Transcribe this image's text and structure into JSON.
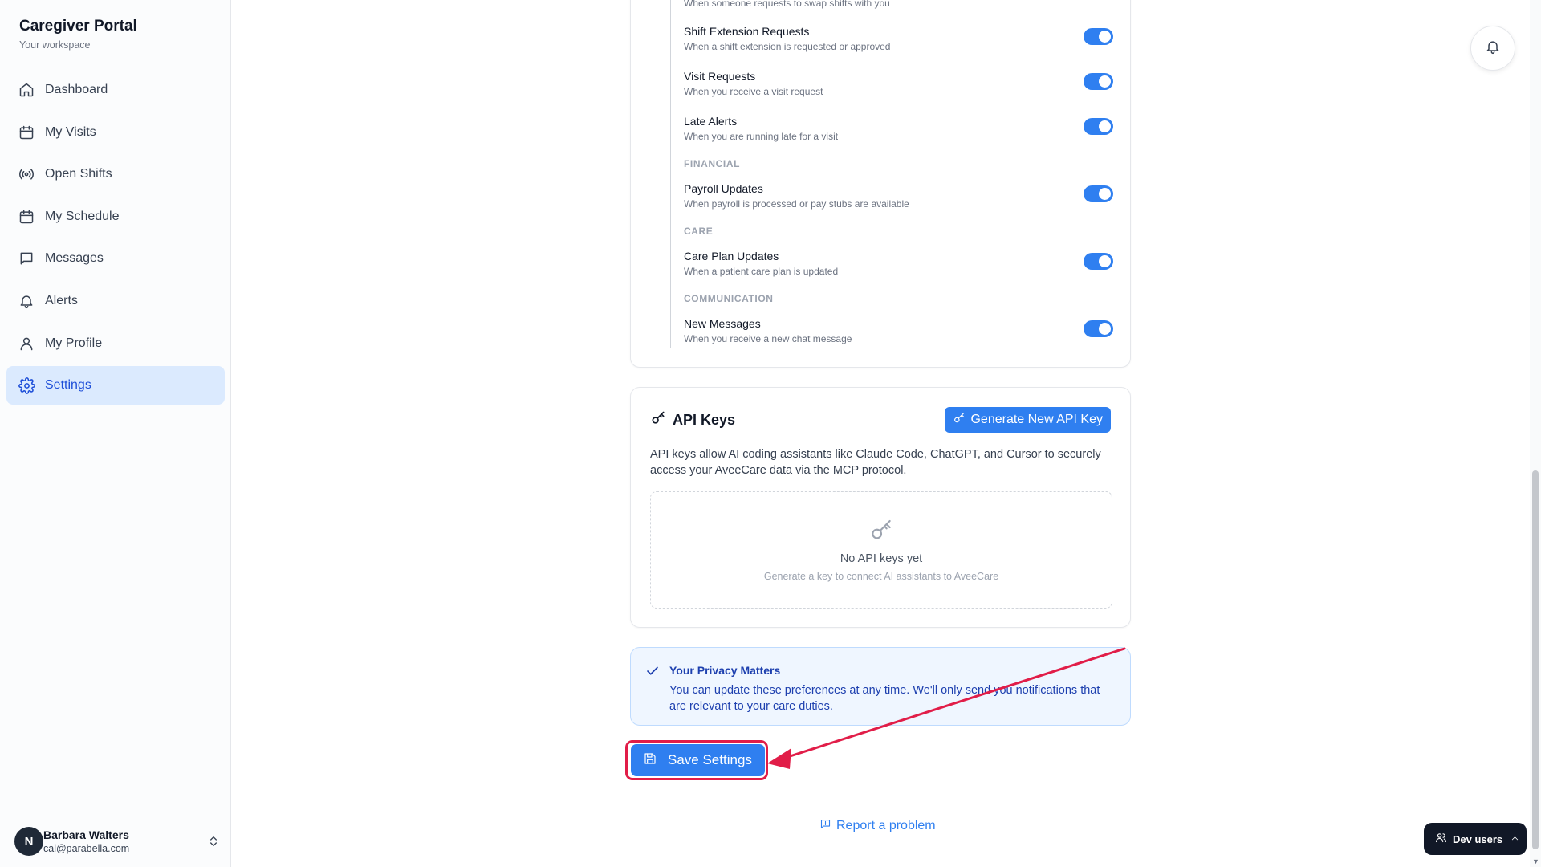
{
  "app": {
    "title": "Caregiver Portal",
    "subtitle": "Your workspace"
  },
  "sidebar": {
    "items": [
      {
        "label": "Dashboard",
        "icon": "home-icon"
      },
      {
        "label": "My Visits",
        "icon": "calendar-icon"
      },
      {
        "label": "Open Shifts",
        "icon": "broadcast-icon"
      },
      {
        "label": "My Schedule",
        "icon": "calendar-icon"
      },
      {
        "label": "Messages",
        "icon": "message-icon"
      },
      {
        "label": "Alerts",
        "icon": "bell-icon"
      },
      {
        "label": "My Profile",
        "icon": "user-icon"
      },
      {
        "label": "Settings",
        "icon": "gear-icon",
        "active": true
      }
    ],
    "user": {
      "initial": "N",
      "name": "Barbara Walters",
      "email": "cal@parabella.com"
    }
  },
  "notifications": {
    "partial_top_desc": "When someone requests to swap shifts with you",
    "rows_a": [
      {
        "title": "Shift Extension Requests",
        "desc": "When a shift extension is requested or approved",
        "enabled": true
      },
      {
        "title": "Visit Requests",
        "desc": "When you receive a visit request",
        "enabled": true
      },
      {
        "title": "Late Alerts",
        "desc": "When you are running late for a visit",
        "enabled": true
      }
    ],
    "sections": {
      "financial": "FINANCIAL",
      "care": "CARE",
      "communication": "COMMUNICATION"
    },
    "payroll": {
      "title": "Payroll Updates",
      "desc": "When payroll is processed or pay stubs are available",
      "enabled": true
    },
    "care_plan": {
      "title": "Care Plan Updates",
      "desc": "When a patient care plan is updated",
      "enabled": true
    },
    "messages": {
      "title": "New Messages",
      "desc": "When you receive a new chat message",
      "enabled": true
    }
  },
  "api_keys": {
    "title": "API Keys",
    "generate_label": "Generate New API Key",
    "description": "API keys allow AI coding assistants like Claude Code, ChatGPT, and Cursor to securely access your AveeCare data via the MCP protocol.",
    "empty_title": "No API keys yet",
    "empty_subtitle": "Generate a key to connect AI assistants to AveeCare"
  },
  "privacy": {
    "title": "Your Privacy Matters",
    "text": "You can update these preferences at any time. We'll only send you notifications that are relevant to your care duties."
  },
  "save_label": "Save Settings",
  "report_label": "Report a problem",
  "dev_users_label": "Dev users",
  "colors": {
    "accent": "#2f7ff0",
    "highlight": "#e11d48",
    "active_nav_bg": "#dbeafe"
  }
}
